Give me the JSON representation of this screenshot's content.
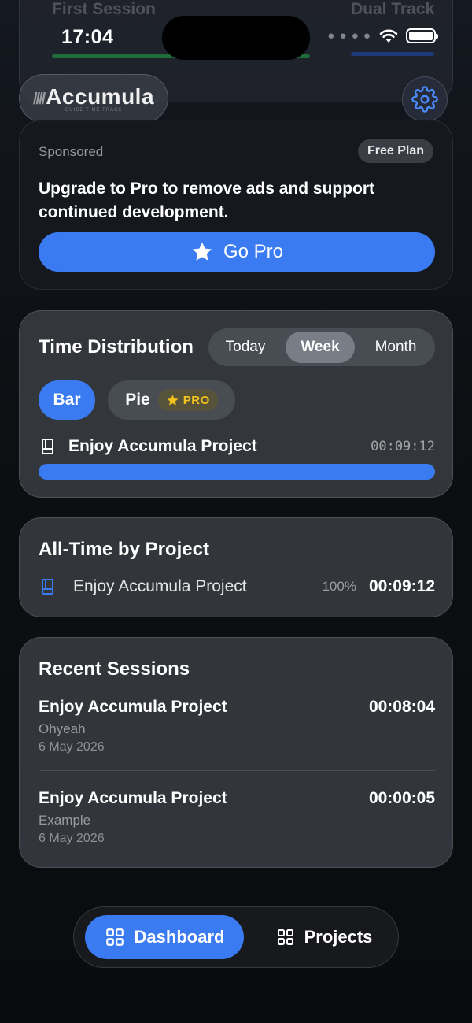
{
  "background_card": {
    "left_text": "First Session",
    "right_text": "Dual Track"
  },
  "status_bar": {
    "time": "17:04"
  },
  "header": {
    "logo_text": "Accumula",
    "logo_tagline": "GUIDE TIME TRACK",
    "settings_icon": "gear-icon"
  },
  "sponsored": {
    "label": "Sponsored",
    "plan_badge": "Free Plan",
    "message": "Upgrade to Pro to remove ads and support continued development.",
    "cta_label": "Go Pro",
    "cta_icon": "star-icon"
  },
  "time_distribution": {
    "title": "Time Distribution",
    "ranges": [
      "Today",
      "Week",
      "Month"
    ],
    "selected_range": "Week",
    "chart_types": {
      "bar_label": "Bar",
      "pie_label": "Pie",
      "pro_badge": "PRO"
    },
    "selected_chart_type": "Bar",
    "rows": [
      {
        "project": "Enjoy Accumula Project",
        "time": "00:09:12",
        "fraction": 1.0,
        "icon": "book-icon"
      }
    ]
  },
  "all_time": {
    "title": "All-Time by Project",
    "rows": [
      {
        "project": "Enjoy Accumula Project",
        "percent": "100%",
        "time": "00:09:12",
        "icon": "book-icon"
      }
    ]
  },
  "recent_sessions": {
    "title": "Recent Sessions",
    "items": [
      {
        "project": "Enjoy Accumula Project",
        "duration": "00:08:04",
        "note": "Ohyeah",
        "date": "6 May 2026"
      },
      {
        "project": "Enjoy Accumula Project",
        "duration": "00:00:05",
        "note": "Example",
        "date": "6 May 2026"
      }
    ]
  },
  "tabbar": {
    "tabs": [
      {
        "label": "Dashboard",
        "active": true,
        "icon": "grid-icon"
      },
      {
        "label": "Projects",
        "active": false,
        "icon": "grid-icon"
      }
    ]
  },
  "colors": {
    "accent": "#3a7bf2",
    "pro_gold": "#f3c21c",
    "card_bg": "#36393f",
    "page_bg": "#0b0d10"
  }
}
